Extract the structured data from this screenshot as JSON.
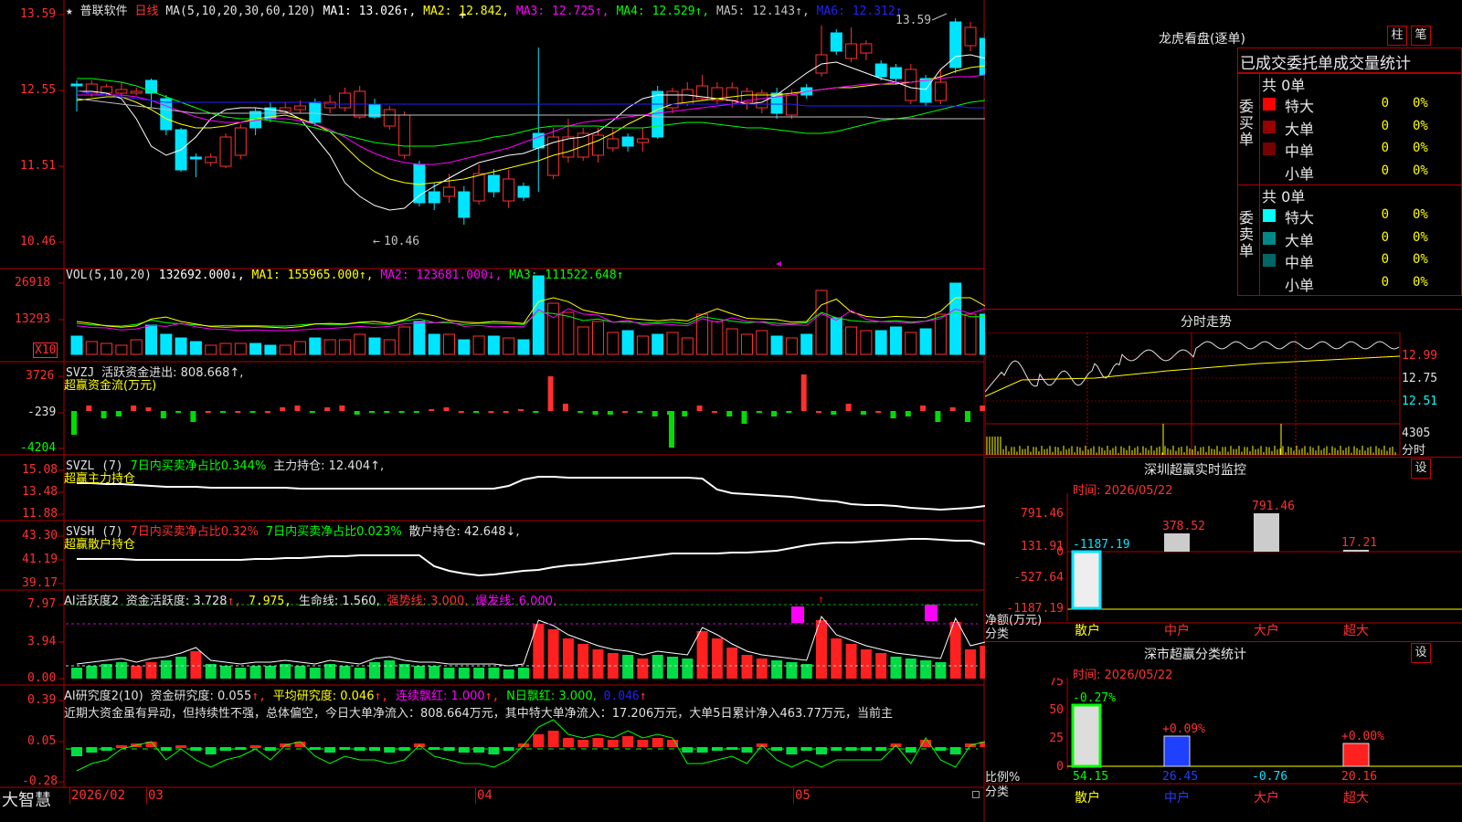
{
  "header": {
    "star": "★",
    "stock_name": "普联软件",
    "period": "日线",
    "ma_label": "MA(5,10,20,30,60,120)",
    "ma1": "MA1: 13.026↑,",
    "ma2": "MA2: 12.842,",
    "ma3": "MA3: 12.725↑,",
    "ma4": "MA4: 12.529↑,",
    "ma5": "MA5: 12.143↑,",
    "ma6": "MA6: 12.312↑"
  },
  "price_axis": {
    "labels": [
      "13.59",
      "12.55",
      "11.51",
      "10.46"
    ],
    "high_mark": "13.59",
    "low_mark": "10.46"
  },
  "vol_panel": {
    "title": "VOL(5,10,20)",
    "value": "132692.000↓,",
    "ma1": "MA1: 155965.000↑,",
    "ma2": "MA2: 123681.000↓,",
    "ma3": "MA3: 111522.648↑",
    "axis": [
      "26918",
      "13293"
    ],
    "unit": "X10"
  },
  "svzj_panel": {
    "title": "SVZJ",
    "line1": "活跃资金进出: 808.668↑,",
    "line2": "超赢资金流(万元)",
    "axis": [
      "3726",
      "-239",
      "-4204"
    ]
  },
  "svzl_panel": {
    "title": "SVZL (7)",
    "desc": "7日内买卖净占比0.344%",
    "hold": "主力持仓: 12.404↑,",
    "line2": "超赢主力持仓",
    "axis": [
      "15.08",
      "13.48",
      "11.88"
    ]
  },
  "svsh_panel": {
    "title": "SVSH (7)",
    "desc1": "7日内买卖净占比0.32%",
    "desc2": "7日内买卖净占比0.023%",
    "hold": "散户持仓: 42.648↓,",
    "line2": "超赢散户持仓",
    "axis": [
      "43.30",
      "41.19",
      "39.17"
    ]
  },
  "ai_active": {
    "title": "AI活跃度2",
    "v1": "资金活跃度: 3.728",
    "v2": "7.975,",
    "v3": "生命线: 1.560,",
    "v4": "强势线: 3.000,",
    "v5": "爆发线: 6.000,",
    "axis": [
      "7.97",
      "3.94",
      "0.00"
    ]
  },
  "ai_research": {
    "title": "AI研究度2(10)",
    "v1": "资金研究度: 0.055",
    "v2": "平均研究度: 0.046",
    "v3": "连续飘红: 1.000",
    "v4": "N日飘红: 3.000,",
    "v5": "0.046",
    "comment": "近期大资金虽有异动，但持续性不强，总体偏空，今日大单净流入：808.664万元，其中特大单净流入：17.206万元，大单5日累计净入463.77万元，当前主",
    "axis": [
      "0.39",
      "0.05",
      "-0.28"
    ]
  },
  "bottom_bar": {
    "brand": "大智慧",
    "year": "2026/02",
    "m1": "03",
    "m2": "04",
    "m3": "05"
  },
  "dragon": {
    "title": "龙虎看盘(逐单)",
    "btn1": "柱",
    "btn2": "笔",
    "tabs": "已成交委托单成交量统计",
    "buy_total": "共 0单",
    "sell_total": "共 0单",
    "buy_label": "委买单",
    "sell_label": "委卖单",
    "rows": [
      "特大",
      "大单",
      "中单",
      "小单"
    ],
    "zero": "0",
    "pct": "0%",
    "buy_colors": [
      "#ff0000",
      "#990000",
      "#770000",
      "#000000"
    ],
    "sell_colors": [
      "#00ffff",
      "#008888",
      "#006666",
      "#000000"
    ]
  },
  "intraday": {
    "title": "分时走势",
    "axis": [
      "12.99",
      "12.75",
      "12.51"
    ],
    "vol": "4305",
    "vol_unit": "分时"
  },
  "sz_monitor": {
    "title": "深圳超赢实时监控",
    "btn": "设",
    "time": "时间: 2026/05/22",
    "axis": [
      "791.46",
      "131.91",
      "0",
      "-527.64",
      "-1187.19"
    ],
    "ylabel1": "净额(万元)",
    "ylabel2": "分类",
    "bar_labels": [
      "-1187.19",
      "378.52",
      "791.46",
      "17.21"
    ],
    "cats": [
      "散户",
      "中户",
      "大户",
      "超大"
    ]
  },
  "sz_class": {
    "title": "深市超赢分类统计",
    "btn": "设",
    "time": "时间: 2026/05/22",
    "axis": [
      "75",
      "50",
      "25",
      "0"
    ],
    "ylabel1": "比例%",
    "ylabel2": "分类",
    "top_labels": [
      "-0.27%",
      "+0.09%",
      "+0.00%"
    ],
    "values": [
      "54.15",
      "26.45",
      "-0.76",
      "20.16"
    ],
    "cats": [
      "散户",
      "中户",
      "大户",
      "超大"
    ]
  }
}
